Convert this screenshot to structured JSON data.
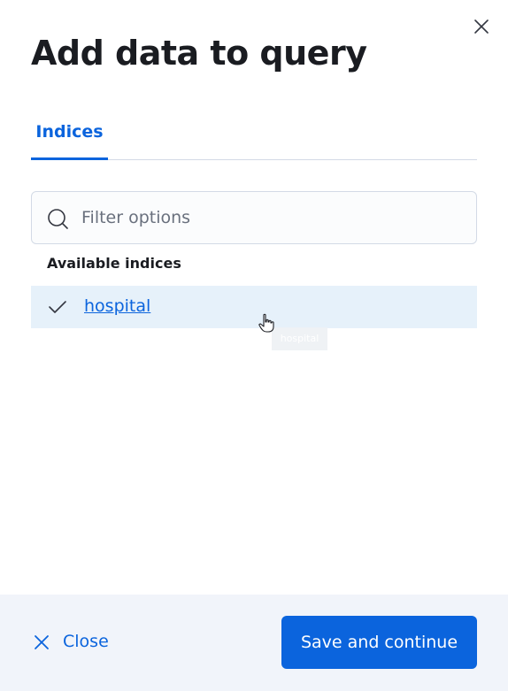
{
  "flyout": {
    "title": "Add data to query",
    "close_icon": "close-icon"
  },
  "tabs": [
    {
      "label": "Indices",
      "selected": true
    }
  ],
  "search": {
    "placeholder": "Filter options",
    "value": "",
    "icon": "search-icon"
  },
  "options": {
    "group_label": "Available indices",
    "items": [
      {
        "label": "hospital",
        "checked": true,
        "icon": "check-icon"
      }
    ]
  },
  "drag_ghost": {
    "label": "hospital"
  },
  "footer": {
    "close_label": "Close",
    "close_icon": "close-icon",
    "save_label": "Save and continue"
  },
  "colors": {
    "accent": "#0b64dd",
    "footer_bg": "#f1f4fa",
    "selected_option_bg": "#e6f1fa"
  }
}
